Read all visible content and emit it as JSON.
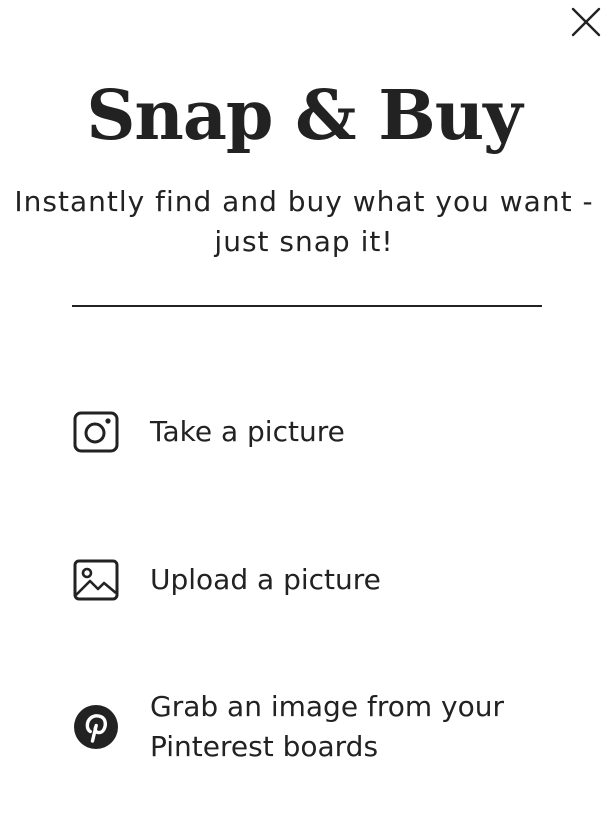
{
  "header": {
    "title": "Snap & Buy",
    "subtitle": "Instantly find and buy what you want - just snap it!",
    "close_icon": "close-icon"
  },
  "options": [
    {
      "label": "Take a picture",
      "icon": "camera-icon"
    },
    {
      "label": "Upload a picture",
      "icon": "image-icon"
    },
    {
      "label": "Grab an image from your Pinterest boards",
      "icon": "pinterest-icon"
    }
  ],
  "colors": {
    "text": "#222222",
    "background": "#ffffff"
  }
}
